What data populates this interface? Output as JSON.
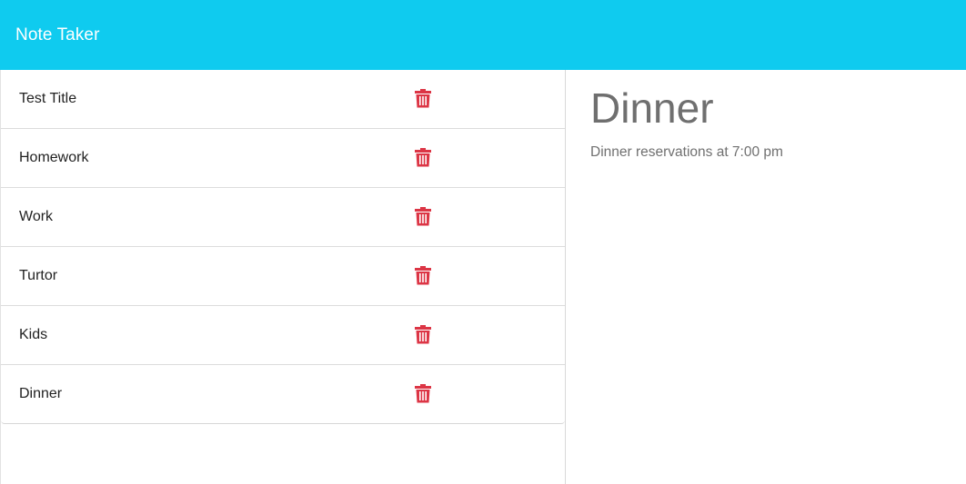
{
  "app": {
    "title": "Note Taker",
    "accent_color": "#0fcbef",
    "delete_color": "#dc3545"
  },
  "notes": [
    {
      "title": "Test Title",
      "icon": "trash-icon"
    },
    {
      "title": "Homework",
      "icon": "trash-icon"
    },
    {
      "title": "Work",
      "icon": "trash-icon"
    },
    {
      "title": "Turtor",
      "icon": "trash-icon"
    },
    {
      "title": "Kids",
      "icon": "trash-icon"
    },
    {
      "title": "Dinner",
      "icon": "trash-icon"
    }
  ],
  "active_note": {
    "title": "Dinner",
    "text": "Dinner reservations at 7:00 pm"
  }
}
